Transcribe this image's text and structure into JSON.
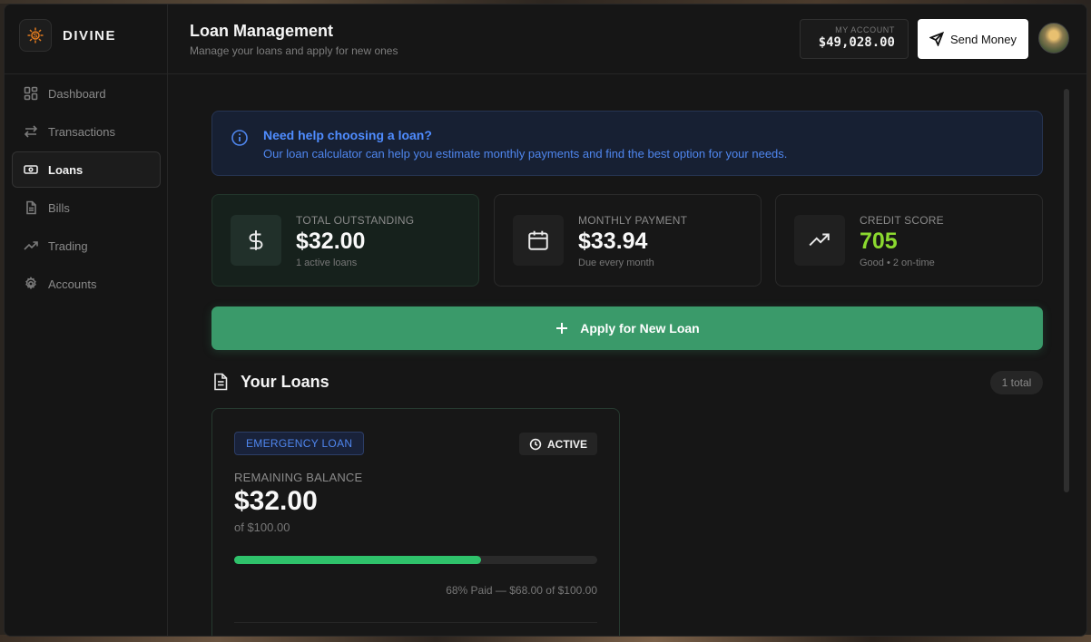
{
  "brand": {
    "name": "DIVINE"
  },
  "sidebar": {
    "items": [
      {
        "label": "Dashboard",
        "icon": "grid-icon",
        "active": false
      },
      {
        "label": "Transactions",
        "icon": "arrows-swap-icon",
        "active": false
      },
      {
        "label": "Loans",
        "icon": "banknote-icon",
        "active": true
      },
      {
        "label": "Bills",
        "icon": "document-icon",
        "active": false
      },
      {
        "label": "Trading",
        "icon": "trending-up-icon",
        "active": false
      },
      {
        "label": "Accounts",
        "icon": "gear-icon",
        "active": false
      }
    ]
  },
  "header": {
    "title": "Loan Management",
    "subtitle": "Manage your loans and apply for new ones",
    "account_label": "MY ACCOUNT",
    "account_value": "$49,028.00",
    "send_label": "Send Money"
  },
  "info": {
    "title": "Need help choosing a loan?",
    "text": "Our loan calculator can help you estimate monthly payments and find the best option for your needs."
  },
  "stats": [
    {
      "label": "TOTAL OUTSTANDING",
      "value": "$32.00",
      "sub": "1 active loans",
      "icon": "dollar-icon"
    },
    {
      "label": "MONTHLY PAYMENT",
      "value": "$33.94",
      "sub": "Due every month",
      "icon": "calendar-icon"
    },
    {
      "label": "CREDIT SCORE",
      "value": "705",
      "sub": "Good • 2 on-time",
      "icon": "trending-up-icon"
    }
  ],
  "apply": {
    "label": "Apply for New Loan"
  },
  "loans_section": {
    "title": "Your Loans",
    "badge": "1 total"
  },
  "loan": {
    "type": "EMERGENCY LOAN",
    "status": "ACTIVE",
    "remaining_label": "REMAINING BALANCE",
    "remaining_value": "$32.00",
    "of_text": "of $100.00",
    "progress_percent": 68,
    "progress_text": "68% Paid — $68.00 of $100.00"
  },
  "colors": {
    "accent_green": "#3a9a6a",
    "progress_green": "#2fc26b",
    "credit_score": "#8bd92f",
    "info_blue": "#4f86ee"
  }
}
